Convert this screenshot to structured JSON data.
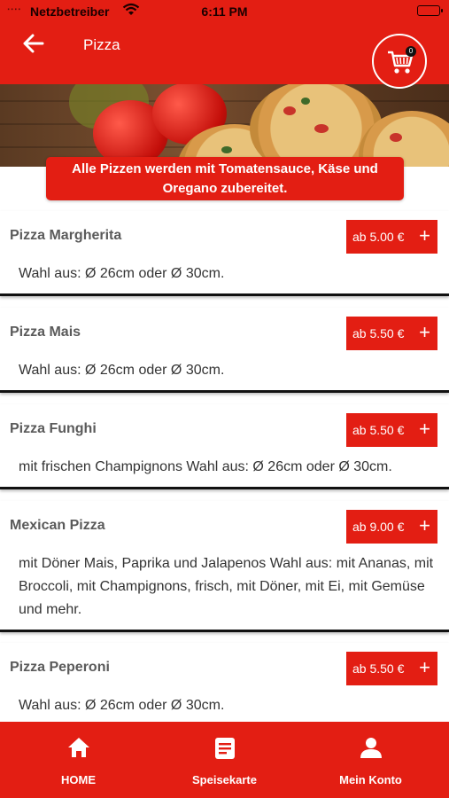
{
  "status_bar": {
    "signal": "∙∙∙∙",
    "carrier": "Netzbetreiber",
    "time": "6:11 PM"
  },
  "header": {
    "title": "Pizza",
    "cart_count": "0"
  },
  "notice": {
    "text_line1": "Alle Pizzen werden mit Tomatensauce, Käse und",
    "text_line2": "Oregano zubereitet."
  },
  "items": [
    {
      "name": "Pizza Margherita",
      "price": "ab 5.00 €",
      "plus": "+",
      "description": "Wahl aus: Ø 26cm oder Ø 30cm."
    },
    {
      "name": "Pizza Mais",
      "price": "ab 5.50 €",
      "plus": "+",
      "description": "Wahl aus: Ø 26cm oder Ø 30cm."
    },
    {
      "name": "Pizza Funghi",
      "price": "ab 5.50 €",
      "plus": "+",
      "description": "mit frischen Champignons Wahl aus: Ø 26cm oder Ø 30cm."
    },
    {
      "name": "Mexican Pizza",
      "price": "ab 9.00 €",
      "plus": "+",
      "description": "mit Döner Mais, Paprika und Jalapenos Wahl aus: mit Ananas, mit Broccoli, mit Champignons, frisch, mit Döner, mit Ei, mit Gemüse und mehr."
    },
    {
      "name": "Pizza Peperoni",
      "price": "ab 5.50 €",
      "plus": "+",
      "description": "Wahl aus: Ø 26cm oder Ø 30cm."
    }
  ],
  "bottom_nav": {
    "home": "HOME",
    "menu": "Speisekarte",
    "account": "Mein Konto"
  },
  "colors": {
    "brand_red": "#e31e13",
    "text_dark": "#333333",
    "text_name": "#5a5a5a"
  }
}
